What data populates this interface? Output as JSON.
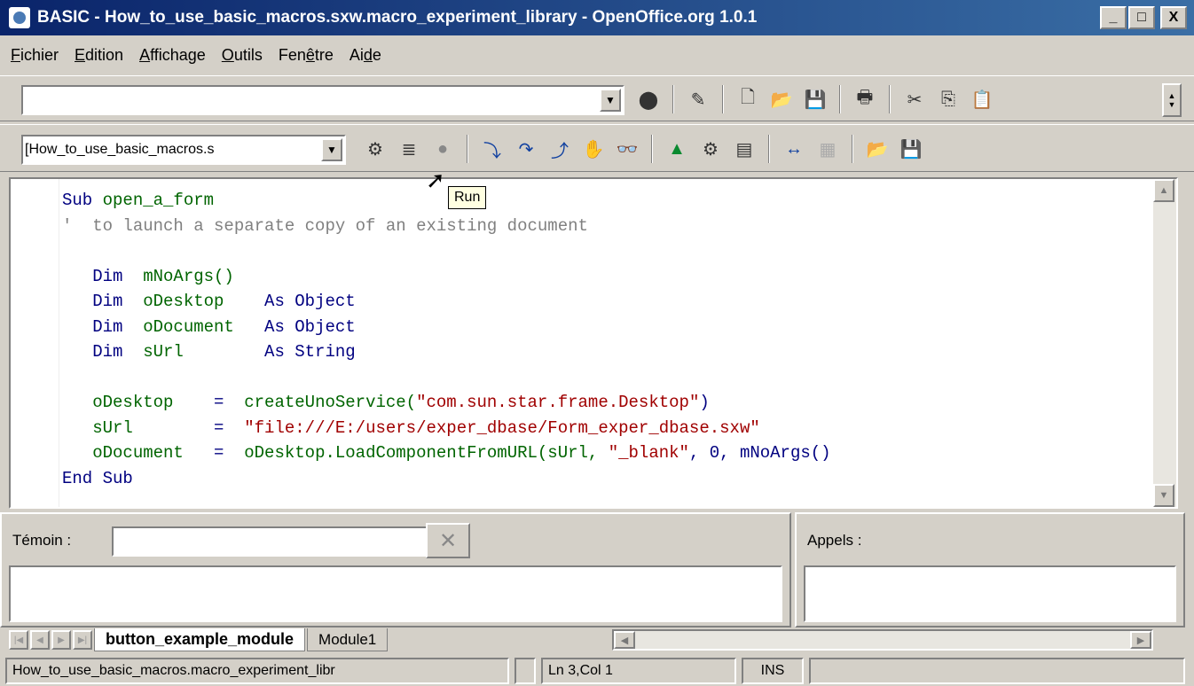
{
  "window": {
    "title": "BASIC - How_to_use_basic_macros.sxw.macro_experiment_library - OpenOffice.org 1.0.1",
    "minimize": "_",
    "maximize": "□",
    "close": "X"
  },
  "menu": [
    {
      "u": "F",
      "rest": "ichier"
    },
    {
      "u": "E",
      "rest": "dition"
    },
    {
      "u": "A",
      "rest": "ffichage"
    },
    {
      "u": "O",
      "rest": "utils"
    },
    {
      "pre": "Fen",
      "u": "ê",
      "rest": "tre"
    },
    {
      "pre": "Ai",
      "u": "d",
      "rest": "e"
    }
  ],
  "toolbar1": {
    "url_value": ""
  },
  "toolbar2": {
    "library_value": "[How_to_use_basic_macros.s"
  },
  "tooltip": "Run",
  "code": {
    "l1": {
      "kw": "Sub ",
      "id": "open_a_form"
    },
    "l2": {
      "cm": "'  to launch a separate copy of an existing document"
    },
    "l4": {
      "kw": "   Dim  ",
      "id": "mNoArgs()"
    },
    "l5": {
      "kw": "   Dim  ",
      "id": "oDesktop   ",
      "kw2": " As Object"
    },
    "l6": {
      "kw": "   Dim  ",
      "id": "oDocument  ",
      "kw2": " As Object"
    },
    "l7": {
      "kw": "   Dim  ",
      "id": "sUrl       ",
      "kw2": " As String"
    },
    "l9": {
      "id": "   oDesktop   ",
      "op": " =  ",
      "id2": "createUnoService(",
      "st": "\"com.sun.star.frame.Desktop\"",
      "end": ")"
    },
    "l10": {
      "id": "   sUrl       ",
      "op": " =  ",
      "st": "\"file:///E:/users/exper_dbase/Form_exper_dbase.sxw\""
    },
    "l11": {
      "id": "   oDocument  ",
      "op": " =  ",
      "id2": "oDesktop.LoadComponentFromURL(sUrl, ",
      "st": "\"_blank\"",
      "end": ", 0, mNoArgs()"
    },
    "l12": {
      "kw": "End Sub"
    }
  },
  "watch": {
    "label": "Témoin :",
    "value": ""
  },
  "calls": {
    "label": "Appels :"
  },
  "tabs": [
    {
      "label": "button_example_module",
      "active": true
    },
    {
      "label": "Module1",
      "active": false
    }
  ],
  "status": {
    "module": "How_to_use_basic_macros.macro_experiment_libr",
    "position": "Ln 3,Col 1",
    "mode": "INS"
  }
}
